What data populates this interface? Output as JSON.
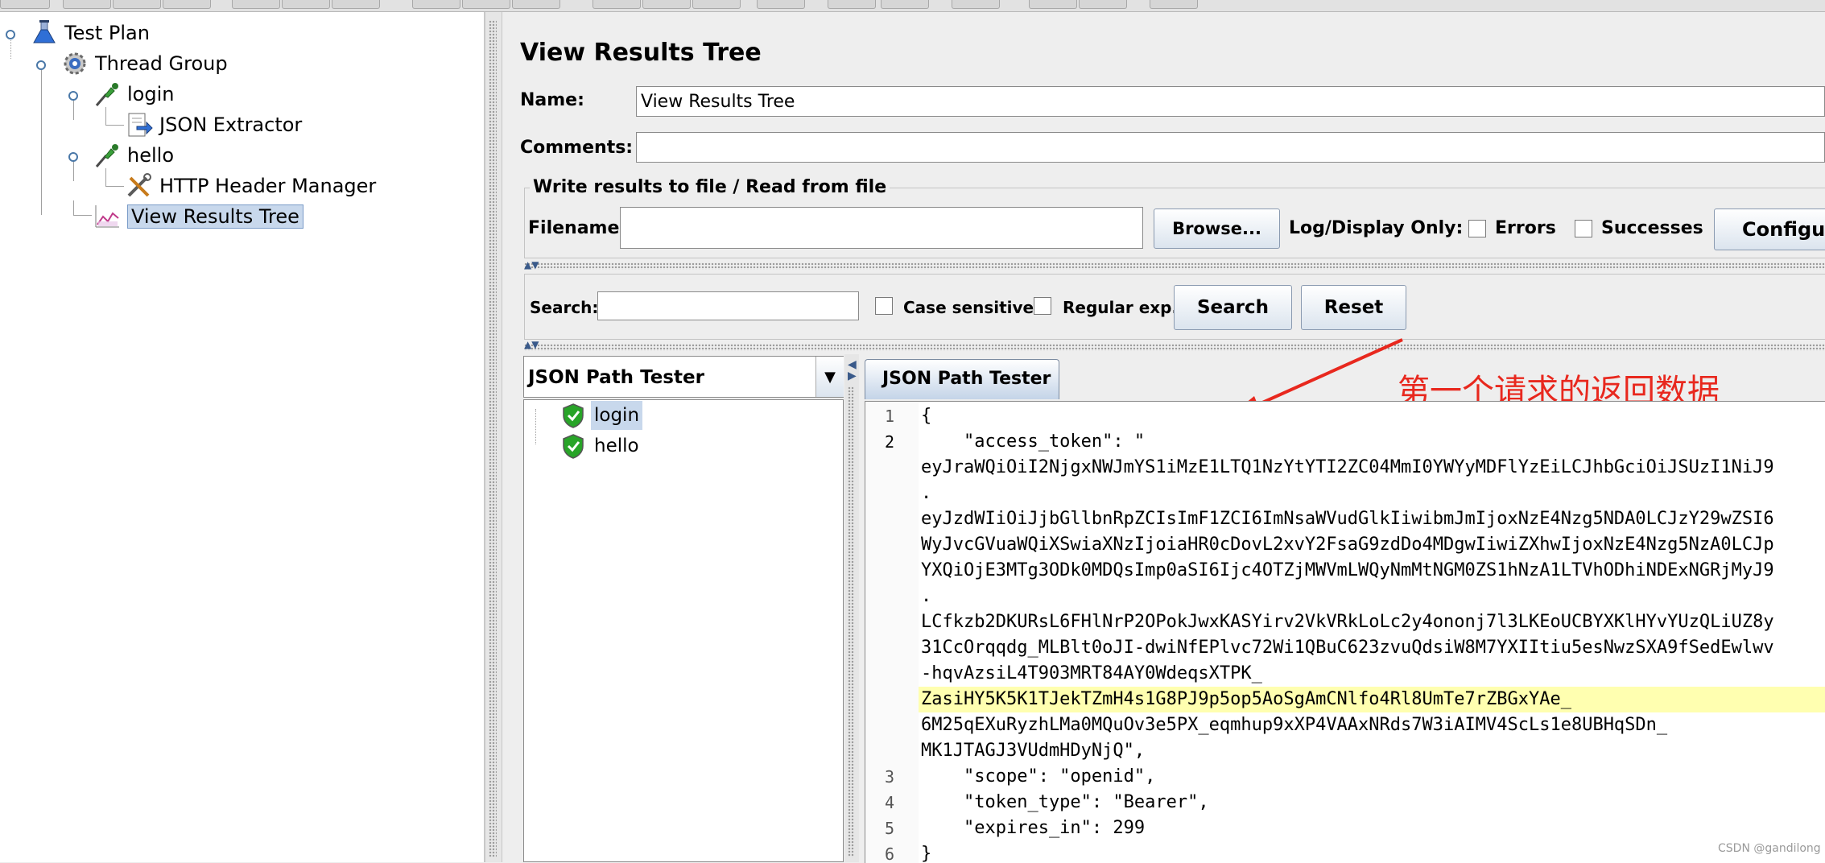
{
  "tree": {
    "nodes": [
      {
        "label": "Test Plan",
        "icon": "flask-icon"
      },
      {
        "label": "Thread Group",
        "icon": "gear-icon"
      },
      {
        "label": "login",
        "icon": "pipette-icon"
      },
      {
        "label": "JSON Extractor",
        "icon": "extractor-icon"
      },
      {
        "label": "hello",
        "icon": "pipette-icon"
      },
      {
        "label": "HTTP Header Manager",
        "icon": "wrench-icon"
      },
      {
        "label": "View Results Tree",
        "icon": "chart-icon",
        "selected": true
      }
    ]
  },
  "panel": {
    "title": "View Results Tree",
    "name_label": "Name:",
    "name_value": "View Results Tree",
    "comments_label": "Comments:",
    "comments_value": "",
    "file_section_title": "Write results to file / Read from file",
    "filename_label": "Filename",
    "filename_value": "",
    "browse_label": "Browse...",
    "log_display_label": "Log/Display Only:",
    "errors_label": "Errors",
    "successes_label": "Successes",
    "configure_label": "Configure"
  },
  "search": {
    "label": "Search:",
    "value": "",
    "case_sensitive_label": "Case sensitive",
    "regular_exp_label": "Regular exp.",
    "search_button": "Search",
    "reset_button": "Reset"
  },
  "renderer": {
    "selected": "JSON Path Tester"
  },
  "results": [
    {
      "label": "login",
      "status": "success",
      "selected": true
    },
    {
      "label": "hello",
      "status": "success"
    }
  ],
  "tab": {
    "label": "JSON Path Tester"
  },
  "annotation": {
    "text": "第一个请求的返回数据",
    "color": "#e8281e"
  },
  "code": {
    "line_numbers": [
      "1",
      "2",
      "3",
      "4",
      "5",
      "6"
    ],
    "lines": [
      "{",
      "    \"access_token\": \"",
      "eyJraWQiOiI2NjgxNWJmYS1iMzE1LTQ1NzYtYTI2ZC04MmI0YWYyMDFlYzEiLCJhbGciOiJSUzI1NiJ9",
      ".",
      "eyJzdWIiOiJjbGllbnRpZCIsImF1ZCI6ImNsaWVudGlkIiwibmJmIjoxNzE4Nzg5NDA0LCJzY29wZSI6",
      "WyJvcGVuaWQiXSwiaXNzIjoiaHR0cDovL2xvY2FsaG9zdDo4MDgwIiwiZXhwIjoxNzE4Nzg5NzA0LCJp",
      "YXQiOjE3MTg3ODk0MDQsImp0aSI6Ijc4OTZjMWVmLWQyNmMtNGM0ZS1hNzA1LTVhODhiNDExNGRjMyJ9",
      ".",
      "LCfkzb2DKURsL6FHlNrP2OPokJwxKASYirv2VkVRkLoLc2y4ononj7l3LKEoUCBYXKlHYvYUzQLiUZ8y",
      "31CcOrqqdg_MLBlt0oJI-dwiNfEPlvc72Wi1QBuC623zvuQdsiW8M7YXIItiu5esNwzSXA9fSedEwlwv",
      "-hqvAzsiL4T903MRT84AY0WdeqsXTPK_",
      "ZasiHY5K5K1TJekTZmH4s1G8PJ9p5op5AoSgAmCNlfo4Rl8UmTe7rZBGxYAe_",
      "6M25qEXuRyzhLMa0MQuOv3e5PX_eqmhup9xXP4VAAxNRds7W3iAIMV4ScLs1e8UBHqSDn_",
      "MK1JTAGJ3VUdmHDyNjQ\",",
      "    \"scope\": \"openid\",",
      "    \"token_type\": \"Bearer\",",
      "    \"expires_in\": 299",
      "}"
    ]
  },
  "watermark": "CSDN @gandilong"
}
